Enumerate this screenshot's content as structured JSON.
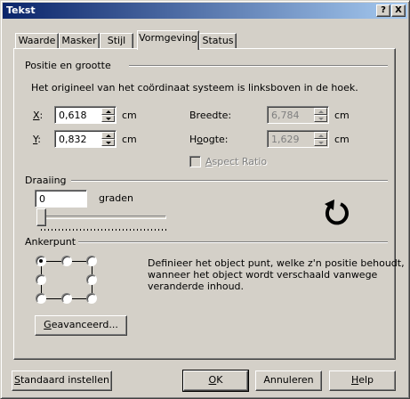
{
  "window": {
    "title": "Tekst",
    "help_btn": "?",
    "close_btn": "X"
  },
  "tabs": [
    "Waarde",
    "Masker",
    "Stijl",
    "Vormgeving",
    "Status"
  ],
  "active_tab": "Vormgeving",
  "position_group": {
    "label": "Positie en grootte",
    "info": "Het origineel van het coördinaat systeem is linksboven in de hoek.",
    "x": {
      "label_key": "X",
      "label_rest": ":",
      "value": "0,618",
      "unit": "cm"
    },
    "y": {
      "label_key": "Y",
      "label_rest": ":",
      "value": "0,832",
      "unit": "cm"
    },
    "width": {
      "label_pre": "Breedte:",
      "value": "6,784",
      "unit": "cm"
    },
    "height": {
      "label_pre": "H",
      "label_key": "o",
      "label_rest": "ogte:",
      "value": "1,629",
      "unit": "cm"
    },
    "aspect_ratio": {
      "label_key": "A",
      "label_rest": "spect Ratio",
      "checked": false
    }
  },
  "rotation_group": {
    "label": "Draaiing",
    "value": "0",
    "unit": "graden",
    "slider_fraction": 0.0,
    "icon": "rotate-icon"
  },
  "anchor_group": {
    "label": "Ankerpunt",
    "description_lines": [
      "Definieer het object punt, welke z'n positie behoudt,",
      "wanneer het object wordt verschaald vanwege",
      "veranderde inhoud."
    ],
    "selected": "top-left",
    "advanced_key": "G",
    "advanced_rest": "eavanceerd..."
  },
  "footer": {
    "defaults_key": "S",
    "defaults_rest": "tandaard instellen",
    "ok_key": "O",
    "ok_rest": "K",
    "cancel": "Annuleren",
    "help_key": "H",
    "help_rest": "elp"
  }
}
